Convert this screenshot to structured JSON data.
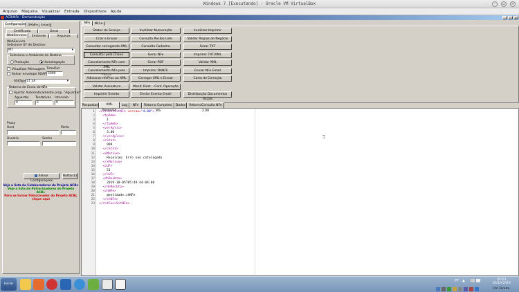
{
  "vbox": {
    "title": "Windows 7 [Executando] - Oracle VM VirtualBox",
    "menu": [
      "Arquivo",
      "Máquina",
      "Visualizar",
      "Entrada",
      "Dispositivos",
      "Ajuda"
    ],
    "status_right": "Ctrl Direito"
  },
  "app": {
    "title": "ACBrNFe - Demonstração"
  },
  "left": {
    "top_tabs": [
      "Configurações",
      "DANFe",
      "Email"
    ],
    "sub_tabs_row1": [
      "Certificado",
      "Geral"
    ],
    "sub_tabs_row2": [
      "WebServices",
      "Emitente",
      "Arquivos"
    ],
    "webservice_group": "WebService",
    "uf_label": "Selecione UF de Destino:",
    "uf_value": "MT",
    "ambiente_label": "Selecione o Ambiente de Destino",
    "producao": "Produção",
    "homologacao": "Homologação",
    "visualizar_msgs": "Visualizar Mensagem",
    "timeout_label": "TimeOut",
    "timeout_value": "5000",
    "salvar_envelope": "Salvar envelope SOAP",
    "ssltype_label": "SSLType",
    "ssltype_value": "LT_all",
    "retorno_label": "Retorno de Envio de NFe",
    "ajustar_label": "Ajustar Automaticamente prop. \"Aguardar\"",
    "aguardar_label": "Aguardar",
    "aguardar_value": "0",
    "tentativas_label": "Tentativas",
    "tentativas_value": "5",
    "intervalo_label": "Intervalo",
    "intervalo_value": "0",
    "proxy_label": "Proxy",
    "host_label": "Host",
    "porta_label": "Porta",
    "usuario_label": "Usuário",
    "senha_label": "Senha",
    "salvar_button": "Salvar Configurações",
    "button13": "Button13",
    "link1": "Veja a lista de Colaboradores do Projeto ACBr.",
    "link2": "Veja a lista de Patrocinadores do Projeto ACBr.",
    "link3": "Para se tornar Patrocinador do Projeto ACBr,",
    "link4": "clique aqui"
  },
  "right_tabs": [
    "NFe",
    "NFCe"
  ],
  "grid_buttons": [
    [
      "Status de Serviço",
      "Inutilizar Numeração",
      "Inutilizar Imprimir"
    ],
    [
      "Criar e Enviar",
      "Consulta Recibo Lote",
      "Validar Regras de Negócio"
    ],
    [
      "Consultar carregando XML",
      "Consulta Cadastro",
      "Gerar TXT"
    ],
    [
      "Consultar pela Chave",
      "Gerar NFe",
      "Imprimir TXT/XML"
    ],
    [
      "Cancelamento NFe com XML",
      "Gerar PDF",
      "Validar XML"
    ],
    [
      "Cancelamento NFe pela Chave",
      "Imprimir DANFE",
      "Enviar NFe Email"
    ],
    [
      "Adicionar nfeProc ao XML",
      "Carregar XML e Enviar",
      "Carta de Correção"
    ],
    [
      "Validar Assinatura",
      "Manif. Dest. - Conf. Operação",
      ""
    ],
    [
      "Imprimir Evento",
      "Enviar Evento Email",
      "Distribuição Documentos Fiscais"
    ]
  ],
  "bottom_tabs": [
    "Respostas",
    "XML Resposta",
    "Log",
    "NFe",
    "Retorno Completo WS",
    "Dados",
    "RetornoConsulta NFe 2.00"
  ],
  "code_lines": [
    [
      "<retConsSitNFe ",
      "versao=",
      "\"4.00\"",
      ">"
    ],
    [
      "  <tpAmb>"
    ],
    [
      "    1"
    ],
    [
      "  </tpAmb>"
    ],
    [
      "  <verAplic>"
    ],
    [
      "    3.00"
    ],
    [
      "  </verAplic>"
    ],
    [
      "  <cStat>"
    ],
    [
      "    999"
    ],
    [
      "  </cStat>"
    ],
    [
      "  <xMotivo>"
    ],
    [
      "    Rejeicao: Erro nao catalogado"
    ],
    [
      "  </xMotivo>"
    ],
    [
      "  <cUF>"
    ],
    [
      "    51"
    ],
    [
      "  </cUF>"
    ],
    [
      "  <dhRecbto>"
    ],
    [
      "    2019-10-05T05:49:44-04:00"
    ],
    [
      "  </dhRecbto>"
    ],
    [
      "  <chNFe>"
    ],
    [
      "    @entidade.chNFe"
    ],
    [
      "  </chNFe>"
    ],
    [
      "</retConsSitNFe>"
    ]
  ],
  "taskbar": {
    "start_label": "Iniciar",
    "lang": "PT",
    "time": "05:53",
    "date": "05/10/2019"
  }
}
